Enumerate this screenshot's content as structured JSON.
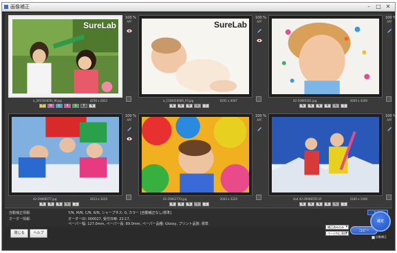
{
  "window": {
    "title": "画像補正"
  },
  "cells": [
    {
      "percent": "100 %",
      "apf": "APF",
      "watermark": "SureLab",
      "filename": "a_20150305Ri_M.jpg",
      "size": "4256 x 2832",
      "color_buttons": [
        "Y",
        "M",
        "C",
        "R",
        "G",
        "K"
      ],
      "icon_buttons": [
        "N"
      ]
    },
    {
      "percent": "100 %",
      "apf": "APF",
      "watermark": "SureLab",
      "filename": "a_1104410066_F0.jpg",
      "size": "6201 x 4047",
      "icon_buttons": [
        "N",
        "N",
        "N",
        "✎",
        "1"
      ]
    },
    {
      "percent": "100 %",
      "apf": "APF",
      "filename": "42-10085161.jpg",
      "size": "4200 x 4200",
      "icon_buttons": [
        "N",
        "N",
        "N",
        "N",
        "✎",
        "1"
      ]
    },
    {
      "percent": "100 %",
      "apf": "APF",
      "filename": "42-29066577.jpg",
      "size": "2413 x 3220",
      "icon_buttons": [
        "N",
        "N",
        "N",
        "✎",
        "1"
      ]
    },
    {
      "percent": "100 %",
      "apf": "APF",
      "filename": "42-29062770.jpg",
      "size": "2043 x 3220",
      "icon_buttons": [
        "N",
        "N",
        "N",
        "✎",
        "1"
      ]
    },
    {
      "percent": "100 %",
      "apf": "APF",
      "filename": "4a4 42-29066555.tif",
      "size": "2160 x 1440",
      "icon_buttons": [
        "N",
        "N",
        "N",
        "N",
        "✎",
        "1"
      ]
    }
  ],
  "info": {
    "row1_label": "自動補正情報:",
    "row1_value": "Y/N, M/N, C/N, R/N, シャープネス: 0, カラー [自動補正なし/標準]",
    "row2_label": "オーダー情報:",
    "row2_value": "オーダーID: 000027, 受付日時: 22:17,",
    "row3_value": "ペーパー幅: 127.0mm, ペーパー長: 89.0mm, ペーパー品種: Glossy, プリント品質: 標準",
    "counter": "1 / 1"
  },
  "bottom": {
    "close_label": "閉じる",
    "help_label": "ヘルプ",
    "dropdown1": "補正済みのみ",
    "dropdown2": "ページ内に適用",
    "copy_label": "コピー",
    "confirm_label": "確定",
    "checkbox_label": "自動補正"
  },
  "colors": {
    "accent": "#2c5fc6",
    "background": "#2b2b2b"
  }
}
